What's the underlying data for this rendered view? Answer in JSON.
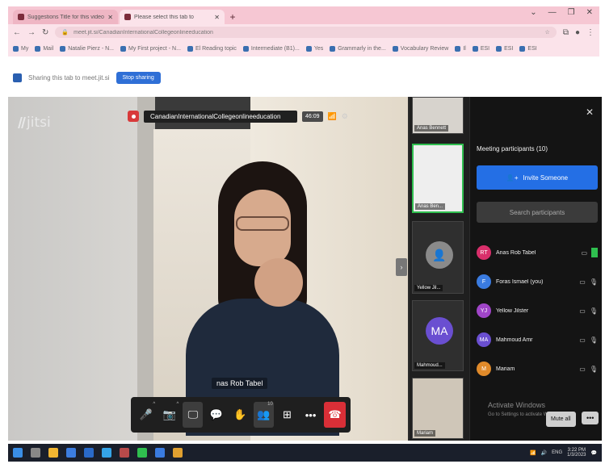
{
  "browser": {
    "tabs": [
      {
        "title": "Suggestions Title for this video",
        "active": false
      },
      {
        "title": "Please select this tab to",
        "active": true
      }
    ],
    "new_tab": "+",
    "window_controls": [
      "⌄",
      "—",
      "❐",
      "✕"
    ],
    "url": "meet.jit.si/CanadianInternationalCollegeonlineeducation",
    "bookmarks": [
      "My",
      "Mail",
      "Natalie Pierz - N...",
      "My First project - N...",
      "El Reading topic",
      "Intermediate (B1)...",
      "Yes",
      "Grammarly in the...",
      "Vocabulary Review",
      "Il",
      "ESI",
      "ESI",
      "ESI"
    ]
  },
  "share_bar": {
    "message": "Sharing this tab to meet.jit.si",
    "stop_button": "Stop sharing"
  },
  "jitsi": {
    "logo": "jitsi",
    "room_name": "CanadianInternationalCollegeonlineeducation",
    "timer": "46:09",
    "main_speaker_name": "nas Rob Tabel",
    "toolbar": {
      "mic": "🎤",
      "camera": "📷",
      "share": "🖵",
      "chat": "💬",
      "raise_hand": "✋",
      "participants": "👥",
      "participants_count": "10",
      "tile": "⊞",
      "more": "•••",
      "hangup": "☎"
    },
    "filmstrip": [
      {
        "label": "Anas Bennett"
      },
      {
        "label": "Anas Ben..."
      },
      {
        "label": "Yellow Jil..."
      },
      {
        "label": "Mahmoud..."
      },
      {
        "label": "Mariam"
      }
    ],
    "filmstrip_avatar_initials": "MA",
    "panel": {
      "close": "✕",
      "heading": "Meeting participants (10)",
      "invite": "Invite Someone",
      "search_placeholder": "Search participants",
      "participants": [
        {
          "initials": "RT",
          "name": "Anas Rob Tabel",
          "color": "#d92f6b"
        },
        {
          "initials": "F",
          "name": "Foras Ismael (you)",
          "color": "#3a7be0"
        },
        {
          "initials": "YJ",
          "name": "Yellow Jilster",
          "color": "#a045c8"
        },
        {
          "initials": "MA",
          "name": "Mahmoud Amr",
          "color": "#6a4fd1"
        },
        {
          "initials": "M",
          "name": "Mariam",
          "color": "#e08a2a"
        }
      ],
      "watermark_line1": "Activate Windows",
      "watermark_line2": "Go to Settings to activate Windows.",
      "mute_all": "Mute all",
      "more": "•••"
    }
  },
  "taskbar": {
    "time": "3:22 PM",
    "date": "1/3/2023",
    "lang": "ENG"
  }
}
